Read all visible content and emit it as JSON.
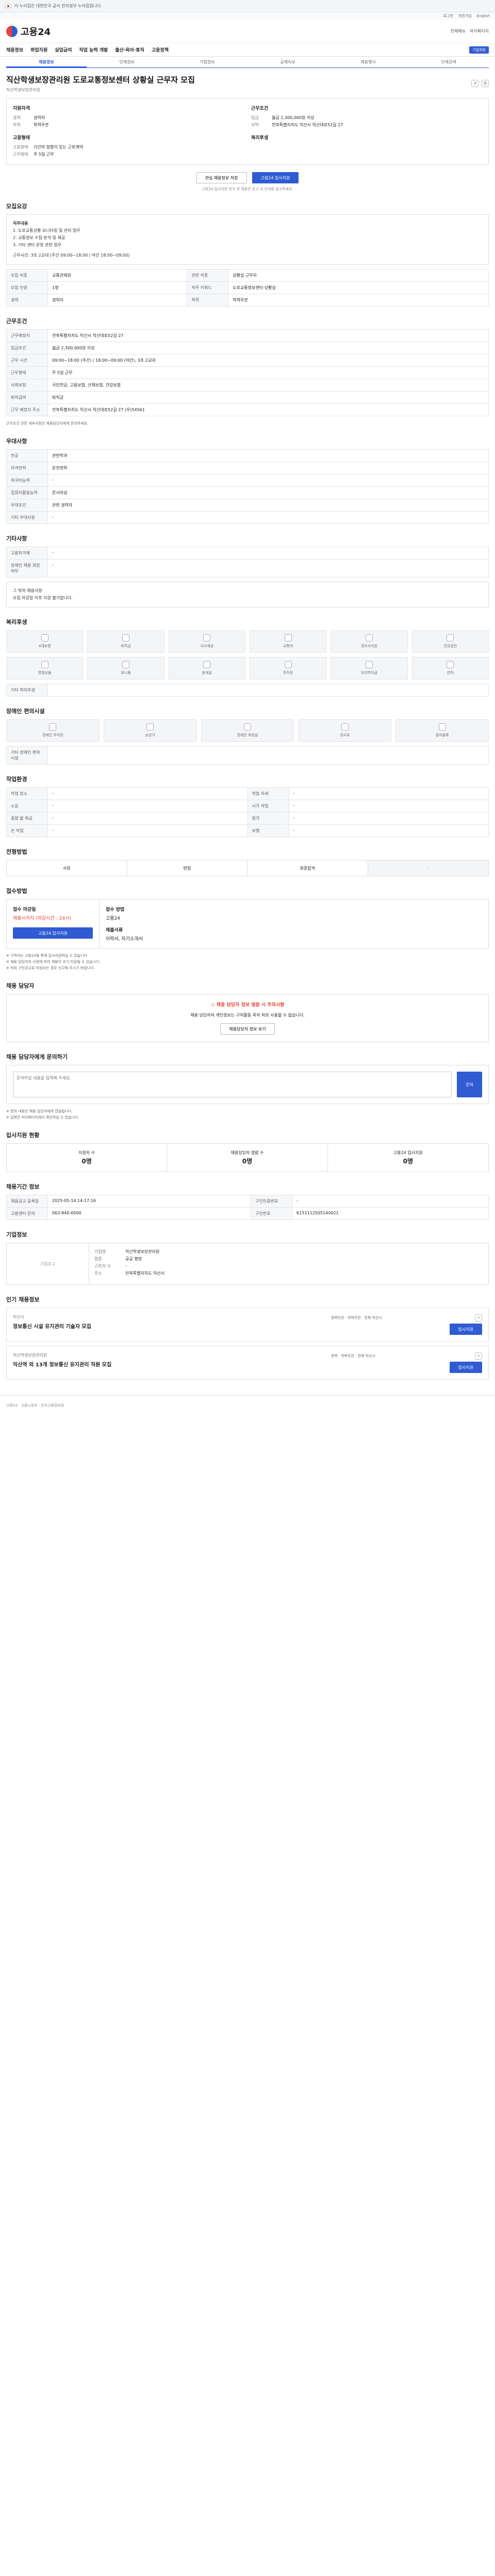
{
  "gov_bar": {
    "text": "이 누리집은 대한민국 공식 전자정부 누리집입니다."
  },
  "top_links": [
    "로그인",
    "회원가입",
    "English"
  ],
  "header": {
    "logo": "고용24",
    "links": [
      "전체메뉴",
      "마이페이지"
    ]
  },
  "gnb": {
    "items": [
      "채용정보",
      "취업지원",
      "실업급여",
      "직업 능력 개발",
      "출산·육아·휴직",
      "고용정책"
    ],
    "pill": "기업회원"
  },
  "tabs": [
    "채용정보",
    "인재정보",
    "기업정보",
    "공채속보",
    "채용행사",
    "인재검색"
  ],
  "job": {
    "title": "직산학생보장관리원 도로교통정보센터 상황실 근무자 모집",
    "company": "직산학생보장관리원",
    "summary_left_title": "지원자격",
    "summary_left": [
      {
        "k": "경력",
        "v": "경력자"
      },
      {
        "k": "학력",
        "v": "학력무관"
      }
    ],
    "summary_right_title": "근무조건",
    "summary_right": [
      {
        "k": "임금",
        "v": "월급 2,300,000원 이상"
      },
      {
        "k": "지역",
        "v": "전북특별자치도 익산시 익산대로52길 27"
      }
    ],
    "summary_left_title2": "고용형태",
    "summary_left2": [
      {
        "k": "고용형태",
        "v": "기간의 정함이 있는 근로계약"
      },
      {
        "k": "근무형태",
        "v": "주 5일 근무"
      }
    ],
    "summary_right_title2": "복리후생",
    "apply_button": "고용24 입사지원",
    "save_button": "관심 채용정보 저장",
    "note": "고용24 입사지원 방식 외 채용은 공고 내 안내를 참고하세요."
  },
  "recruit": {
    "title": "모집요강",
    "body_title": "직무내용",
    "lines": [
      "1. 도로교통상황 모니터링 및 관리 업무",
      "2. 교통정보 수집·분석 및 제공",
      "3. 기타 센터 운영 관련 업무"
    ],
    "extra": "근무시간: 3조 2교대 (주간 09:00~18:00 / 야간 18:00~09:00)",
    "rows": [
      {
        "k": "모집 직종",
        "v": "교통관제원"
      },
      {
        "k": "관련 직종",
        "v": "상황실 근무자"
      },
      {
        "k": "모집 인원",
        "v": "1명"
      },
      {
        "k": "직무 키워드",
        "v": "도로교통정보센터·상황실"
      },
      {
        "k": "경력",
        "v": "경력자"
      },
      {
        "k": "학력",
        "v": "학력무관"
      }
    ]
  },
  "conditions": {
    "title": "근무조건",
    "rows": [
      {
        "k": "근무예정지",
        "v": "전북특별자치도 익산시 익산대로52길 27"
      },
      {
        "k": "임금조건",
        "v": "월급 2,300,000원 이상"
      },
      {
        "k": "근무 시간",
        "v": "09:00~18:00 (주간) / 18:00~09:00 (야간), 3조 2교대"
      },
      {
        "k": "근무형태",
        "v": "주 5일 근무"
      },
      {
        "k": "사회보험",
        "v": "국민연금, 고용보험, 산재보험, 건강보험"
      },
      {
        "k": "퇴직급여",
        "v": "퇴직금"
      },
      {
        "k": "근무 예정지 주소",
        "v": "전북특별자치도 익산시 익산대로52길 27 (우)54561"
      }
    ],
    "note": "근무조건 관련 세부사항은 채용담당자에게 문의하세요."
  },
  "preferences": {
    "title": "우대사항",
    "rows": [
      {
        "k": "전공",
        "v": "관련학과"
      },
      {
        "k": "자격면허",
        "v": "운전면허"
      },
      {
        "k": "외국어능력",
        "v": "-"
      },
      {
        "k": "컴퓨터활용능력",
        "v": "문서작성"
      },
      {
        "k": "우대조건",
        "v": "관련 경력자"
      },
      {
        "k": "기타 우대사항",
        "v": "-"
      }
    ]
  },
  "etc": {
    "title": "기타사항",
    "rows": [
      {
        "k": "고용허가제",
        "v": "-"
      },
      {
        "k": "장애인 채용 희망 여부",
        "v": "-"
      }
    ],
    "note": "그 밖의 채용사항\n모집 마감일 이후 지원 불가합니다."
  },
  "welfare": {
    "title": "복리후생",
    "tiles": [
      "4대보험",
      "퇴직금",
      "식사제공",
      "교통비",
      "경조사지원",
      "건강검진",
      "명절선물",
      "유니폼",
      "휴게실",
      "주차장",
      "자녀학자금",
      "연차"
    ],
    "other_label": "기타 복리후생"
  },
  "disability": {
    "title": "장애인 편의시설",
    "tiles": [
      "장애인 주차장",
      "승강기",
      "장애인 화장실",
      "경사로",
      "점자블록"
    ],
    "other_label": "기타 장애인 편의시설"
  },
  "work_env": {
    "title": "작업환경",
    "rows": [
      {
        "k": "작업 장소",
        "v": "-",
        "k2": "작업 자세",
        "v2": "-"
      },
      {
        "k": "소음",
        "v": "-",
        "k2": "시각 작업",
        "v2": "-"
      },
      {
        "k": "중량 물 취급",
        "v": "-",
        "k2": "청각",
        "v2": "-"
      },
      {
        "k": "손 작업",
        "v": "-",
        "k2": "보행",
        "v2": "-"
      }
    ]
  },
  "process": {
    "title": "전형방법",
    "steps": [
      "서류",
      "면접",
      "최종합격",
      "-"
    ]
  },
  "apply": {
    "title": "접수방법",
    "deadline_label": "접수 마감일",
    "deadline": "채용시까지 (마감시간 : 24시)",
    "method_label": "접수 방법",
    "method": "고용24",
    "apply_btn": "고용24 입사지원",
    "doc_label": "제출서류",
    "doc": "이력서, 자기소개서",
    "bullets": [
      "※ 구직자는 고용24를 통해 입사지원하실 수 있습니다.",
      "※ 채용 담당자의 사정에 따라 채용이 조기 마감될 수 있습니다.",
      "※ 허위 구인공고로 의심되는 경우 신고해 주시기 바랍니다."
    ]
  },
  "contact": {
    "title": "채용 담당자",
    "alert_head": "채용 담당자 정보 열람 시 주의사항",
    "alert_body": "채용 담당자의 개인정보는 구직활동 목적 외로 사용할 수 없습니다.",
    "alert_btn": "채용담당자 정보 보기"
  },
  "inquiry": {
    "title": "채용 담당자에게 문의하기",
    "placeholder": "문의하실 내용을 입력해 주세요.",
    "button": "문의",
    "bullets": [
      "※ 문의 내용은 채용 담당자에게 전달됩니다.",
      "※ 답변은 마이페이지에서 확인하실 수 있습니다."
    ]
  },
  "stats": {
    "title": "입사지원 현황",
    "items": [
      {
        "label": "지원자 수",
        "value": "0명"
      },
      {
        "label": "채용담당자 열람 수",
        "value": "0명"
      },
      {
        "label": "고용24 입사지원",
        "value": "0명"
      }
    ]
  },
  "posting": {
    "title": "채용기간 정보",
    "rows": [
      {
        "k": "채용공고 등록일",
        "v": "2025-05-14 14:17:16",
        "k2": "구인인증번호",
        "v2": "-"
      },
      {
        "k": "고용센터 문의",
        "v": "063-840-6500",
        "k2": "구인번호",
        "v2": "K151112505140021"
      }
    ]
  },
  "company": {
    "title": "기업정보",
    "logo_text": "기업로고",
    "rows": [
      {
        "k": "기업명",
        "v": "직산학생보장관리원"
      },
      {
        "k": "업종",
        "v": "공공 행정"
      },
      {
        "k": "근로자 수",
        "v": "-"
      },
      {
        "k": "주소",
        "v": "전북특별자치도 익산시"
      }
    ]
  },
  "related": {
    "title": "인기 채용정보",
    "cards": [
      {
        "company": "익산시",
        "title": "정보통신 시설 유지관리 기술자 모집",
        "meta": "경력무관 · 학력무관 · 전북 익산시",
        "btn": "입사지원"
      },
      {
        "company": "직산학생보장관리원",
        "title": "익산역 외 13개 정보통신 유지관리 직원 모집",
        "meta": "경력 · 학력무관 · 전북 익산시",
        "btn": "입사지원"
      }
    ]
  },
  "footer": {
    "text": "고용24 · 고용노동부 · 한국고용정보원"
  }
}
